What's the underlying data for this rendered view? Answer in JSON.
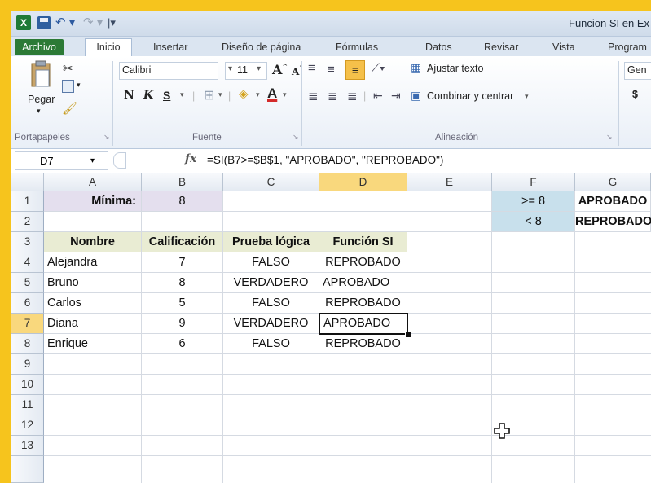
{
  "titlebar": {
    "app_icon": "X",
    "title": "Funcion SI en Ex",
    "icons": [
      "excel-icon",
      "save-icon",
      "undo-icon",
      "redo-icon"
    ]
  },
  "tabs": [
    "Archivo",
    "Inicio",
    "Insertar",
    "Diseño de página",
    "Fórmulas",
    "Datos",
    "Revisar",
    "Vista",
    "Program"
  ],
  "ribbon": {
    "paste_label": "Pegar",
    "group_portapapeles": "Portapapeles",
    "font_name": "Calibri",
    "font_size": "11",
    "group_fuente": "Fuente",
    "bold": "N",
    "italic": "K",
    "underline": "S",
    "wrap_text": "Ajustar texto",
    "merge_center": "Combinar y centrar",
    "group_alineacion": "Alineación",
    "number_format": "Gen",
    "currency": "$"
  },
  "formula_bar": {
    "name_box": "D7",
    "fx": "fx",
    "formula": "=SI(B7>=$B$1, \"APROBADO\", \"REPROBADO\")"
  },
  "grid": {
    "columns": [
      "A",
      "B",
      "C",
      "D",
      "E",
      "F",
      "G"
    ],
    "rows": [
      "1",
      "2",
      "3",
      "4",
      "5",
      "6",
      "7",
      "8",
      "9",
      "10",
      "11",
      "12",
      "13"
    ],
    "selected_cell": "D7",
    "cells": {
      "A1": "Mínima:",
      "B1": "8",
      "F1": ">= 8",
      "G1": "APROBADO",
      "F2": "< 8",
      "G2": "REPROBADO",
      "A3": "Nombre",
      "B3": "Calificación",
      "C3": "Prueba lógica",
      "D3": "Función SI",
      "A4": "Alejandra",
      "B4": "7",
      "C4": "FALSO",
      "D4": "REPROBADO",
      "A5": "Bruno",
      "B5": "8",
      "C5": "VERDADERO",
      "D5": "APROBADO",
      "A6": "Carlos",
      "B6": "5",
      "C6": "FALSO",
      "D6": "REPROBADO",
      "A7": "Diana",
      "B7": "9",
      "C7": "VERDADERO",
      "D7": "APROBADO",
      "A8": "Enrique",
      "B8": "6",
      "C8": "FALSO",
      "D8": "REPROBADO"
    },
    "colors": {
      "header_fill": "#e9ecd3",
      "min_fill": "#e4dfee",
      "criteria_fill": "#c8e0ec",
      "selected_col_fill": "#f9d87d"
    }
  }
}
